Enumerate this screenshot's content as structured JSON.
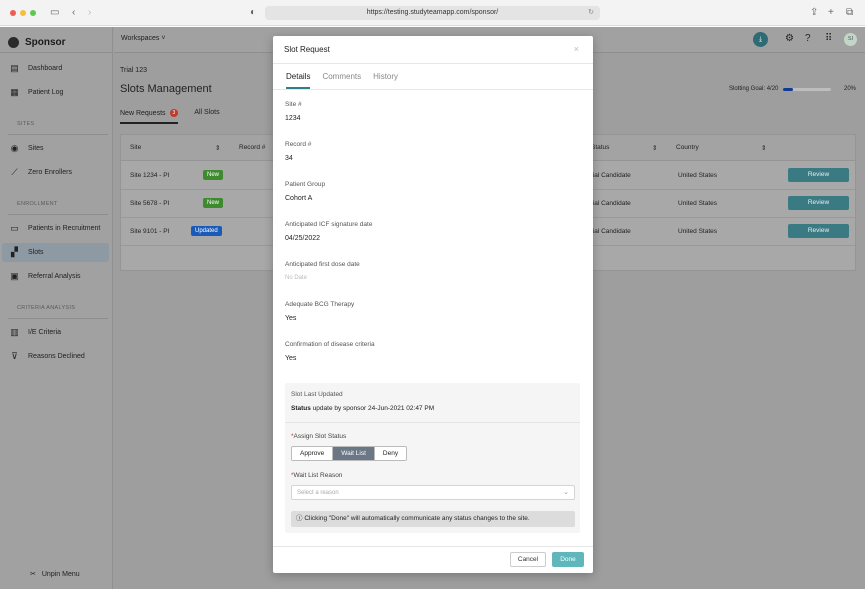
{
  "browser": {
    "url": "https://testing.studyteamapp.com/sponsor/"
  },
  "app": {
    "brand": "Sponsor",
    "workspaces_label": "Workspaces",
    "avatar_initials": "SI"
  },
  "sidebar": {
    "items": [
      {
        "label": "Dashboard",
        "icon": "dashboard-icon"
      },
      {
        "label": "Patient Log",
        "icon": "table-icon"
      }
    ],
    "sections": [
      {
        "title": "SITES",
        "items": [
          {
            "label": "Sites",
            "icon": "location-pin-icon"
          },
          {
            "label": "Zero Enrollers",
            "icon": "trend-icon"
          }
        ]
      },
      {
        "title": "ENROLLMENT",
        "items": [
          {
            "label": "Patients in Recruitment",
            "icon": "card-icon"
          },
          {
            "label": "Slots",
            "icon": "slots-icon"
          },
          {
            "label": "Referral Analysis",
            "icon": "report-icon"
          }
        ]
      },
      {
        "title": "CRITERIA ANALYSIS",
        "items": [
          {
            "label": "I/E Criteria",
            "icon": "bar-chart-icon"
          },
          {
            "label": "Reasons Declined",
            "icon": "thumbs-down-icon"
          }
        ]
      }
    ],
    "unpin_label": "Unpin Menu"
  },
  "page": {
    "trial": "Trial 123",
    "title": "Slots Management",
    "slotting_goal_label": "Slotting Goal:",
    "slotting_goal_value": "4/20",
    "slotting_goal_pct": "20%",
    "slotting_goal_fraction": 0.2,
    "tabs": [
      {
        "label": "New Requests",
        "badge": "3"
      },
      {
        "label": "All Slots"
      }
    ],
    "columns": [
      "Site",
      "Record #",
      "Status",
      "Country"
    ],
    "rows": [
      {
        "site": "Site 1234 - PI",
        "tag": "New",
        "status": "tial Candidate",
        "country": "United States",
        "action": "Review"
      },
      {
        "site": "Site 5678 - PI",
        "tag": "New",
        "status": "tial Candidate",
        "country": "United States",
        "action": "Review"
      },
      {
        "site": "Site 9101 - PI",
        "tag": "Updated",
        "status": "tial Candidate",
        "country": "United States",
        "action": "Review"
      }
    ],
    "tag_colors": {
      "New": "#3d8a2f",
      "Updated": "#1a5bb8"
    }
  },
  "modal": {
    "title": "Slot Request",
    "close": "×",
    "tabs": [
      "Details",
      "Comments",
      "History"
    ],
    "fields": [
      {
        "label": "Site #",
        "value": "1234"
      },
      {
        "label": "Record #",
        "value": "34"
      },
      {
        "label": "Patient Group",
        "value": "Cohort A"
      },
      {
        "label": "Anticipated ICF signature date",
        "value": "04/25/2022"
      },
      {
        "label": "Anticipated first dose date",
        "value": "No Date"
      },
      {
        "label": "Adequate BCG Therapy",
        "value": "Yes"
      },
      {
        "label": "Confirmation of disease criteria",
        "value": "Yes"
      }
    ],
    "slot_last_updated_label": "Slot Last Updated",
    "slot_last_updated_bold": "Status",
    "slot_last_updated_text": "update by sponsor 24-Jun-2021 02:47 PM",
    "assign_label": "Assign Slot Status",
    "status_options": [
      "Approve",
      "Wait List",
      "Deny"
    ],
    "selected_status": "Wait List",
    "waitlist_label": "Wait List Reason",
    "waitlist_placeholder": "Select a reason",
    "info_text": "Clicking \"Done\" will automatically communicate any status changes to the site.",
    "cancel": "Cancel",
    "done": "Done"
  }
}
